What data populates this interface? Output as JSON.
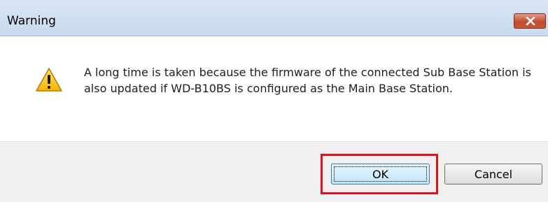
{
  "window": {
    "title": "Warning",
    "close_icon": "close-icon"
  },
  "message": {
    "icon": "warning-triangle-icon",
    "text": "A long time is taken because the firmware of the connected Sub Base Station is also updated if WD-B10BS is configured as the Main Base Station."
  },
  "buttons": {
    "ok_label": "OK",
    "cancel_label": "Cancel"
  },
  "colors": {
    "highlight": "#e0141e",
    "titlebar": "#c8daee",
    "footer": "#f0f0f0"
  }
}
